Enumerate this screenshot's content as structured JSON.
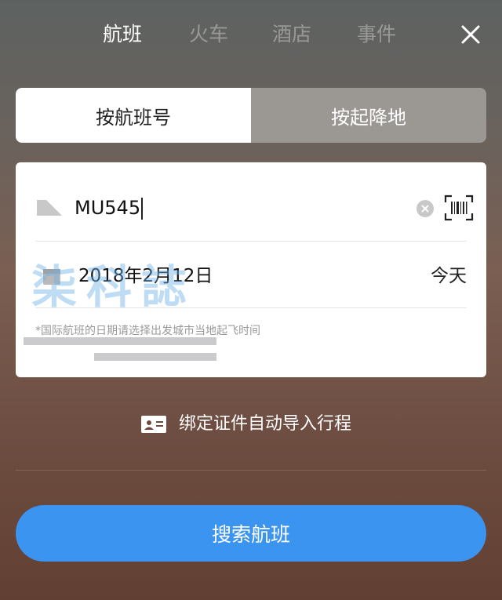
{
  "top_tabs": [
    {
      "label": "航班",
      "active": true
    },
    {
      "label": "火车",
      "active": false
    },
    {
      "label": "酒店",
      "active": false
    },
    {
      "label": "事件",
      "active": false
    }
  ],
  "close_icon": "close-icon",
  "mode_toggle": {
    "by_flight_number": "按航班号",
    "by_route": "按起降地",
    "selected": "by_flight_number"
  },
  "flight_field": {
    "value": "MU545",
    "icon": "plane-icon"
  },
  "date_field": {
    "value": "2018年2月12日",
    "relative": "今天",
    "icon": "calendar-icon"
  },
  "hint": "*国际航班的日期请选择出发城市当地起飞时间",
  "watermark_text": "柒科誌",
  "bind_id": {
    "label": "绑定证件自动导入行程",
    "icon": "id-card-icon"
  },
  "search_button": "搜索航班",
  "colors": {
    "accent": "#3b95f0",
    "inactive_toggle": "#9b9793",
    "card": "#ffffff"
  }
}
